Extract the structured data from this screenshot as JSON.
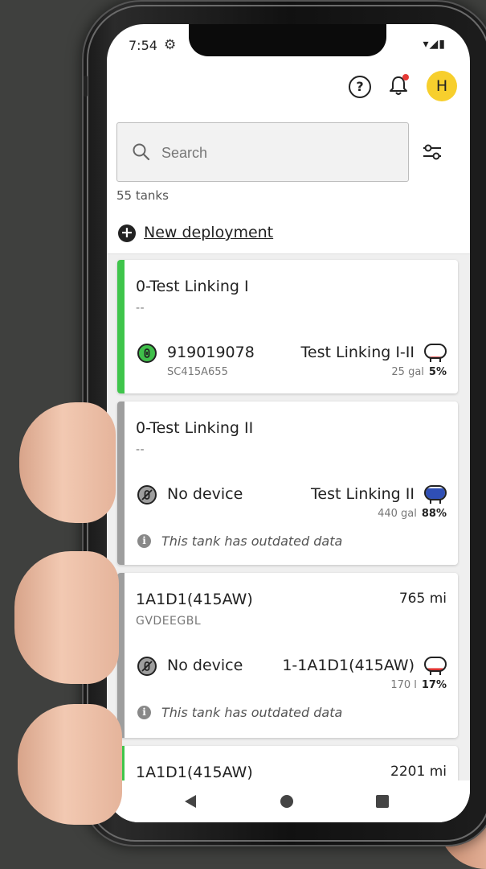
{
  "status_bar": {
    "time": "7:54",
    "gear_icon": "gear-icon",
    "icons": "▾◢▮"
  },
  "header": {
    "avatar_initial": "H",
    "notification_dot_color": "#e53935",
    "avatar_color": "#f7cf2d"
  },
  "search": {
    "placeholder": "Search"
  },
  "tank_count": "55 tanks",
  "new_deployment": {
    "label": "New deployment"
  },
  "cards": [
    {
      "name": "0-Test Linking I",
      "sub": "--",
      "distance": "",
      "status_color": "#3fc54b",
      "device_icon": "device-linked-icon",
      "device_id": "919019078",
      "device_sub": "SC415A655",
      "tank_name": "Test Linking I-II",
      "tank_volume": "25 gal",
      "tank_pct": "5%",
      "tank_fill": 0.05,
      "notice": ""
    },
    {
      "name": "0-Test Linking II",
      "sub": "--",
      "distance": "",
      "status_color": "#9e9e9e",
      "device_icon": "device-unlinked-icon",
      "device_id": "No device",
      "device_sub": "",
      "tank_name": "Test Linking II",
      "tank_volume": "440 gal",
      "tank_pct": "88%",
      "tank_fill": 0.88,
      "notice": "This tank has outdated data"
    },
    {
      "name": "1A1D1(415AW)",
      "sub": "GVDEEGBL",
      "distance": "765 mi",
      "status_color": "#9e9e9e",
      "device_icon": "device-unlinked-icon",
      "device_id": "No device",
      "device_sub": "",
      "tank_name": "1-1A1D1(415AW)",
      "tank_volume": "170 l",
      "tank_pct": "17%",
      "tank_fill": 0.17,
      "notice": "This tank has outdated data"
    },
    {
      "name": "1A1D1(415AW)",
      "sub": "",
      "distance": "2201 mi",
      "status_color": "#3fc54b",
      "notice": ""
    }
  ],
  "nav": {
    "back_icon": "back-triangle-icon",
    "home_icon": "home-circle-icon",
    "recents_icon": "recents-square-icon"
  }
}
